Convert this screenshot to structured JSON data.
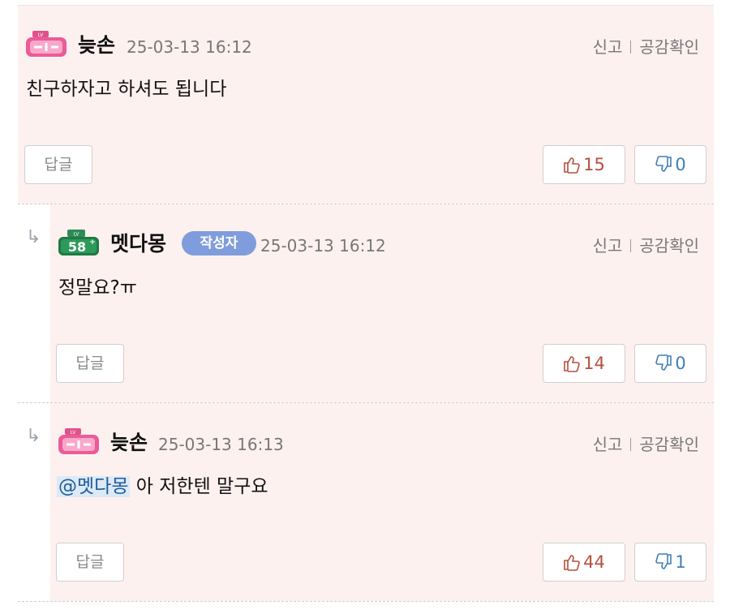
{
  "comments": [
    {
      "level": "main",
      "nickname": "늦손",
      "datetime": "25-03-13 16:12",
      "author_tag": "",
      "report_label": "신고",
      "empathy_label": "공감확인",
      "body": "친구하자고 하셔도 됩니다",
      "mention": "",
      "reply_label": "답글",
      "likes": "15",
      "dislikes": "0"
    },
    {
      "level": "reply",
      "nickname": "멧다몽",
      "datetime": "25-03-13 16:12",
      "author_tag": "작성자",
      "badge_level": "58",
      "report_label": "신고",
      "empathy_label": "공감확인",
      "body": "정말요?ㅠ",
      "mention": "",
      "reply_label": "답글",
      "likes": "14",
      "dislikes": "0"
    },
    {
      "level": "reply",
      "nickname": "늦손",
      "datetime": "25-03-13 16:13",
      "author_tag": "",
      "report_label": "신고",
      "empathy_label": "공감확인",
      "body": "아 저한텐 말구요",
      "mention": "@멧다몽",
      "reply_label": "답글",
      "likes": "44",
      "dislikes": "1"
    }
  ],
  "colors": {
    "comment_bg": "#fdf1ef",
    "like": "#b3503d",
    "dislike": "#3f7fb8",
    "author_tag": "#7f9ddc",
    "mention_bg": "#dce9f7"
  },
  "icons": [
    "level-badge-icon",
    "reply-arrow-icon",
    "thumbs-up-icon",
    "thumbs-down-icon"
  ]
}
